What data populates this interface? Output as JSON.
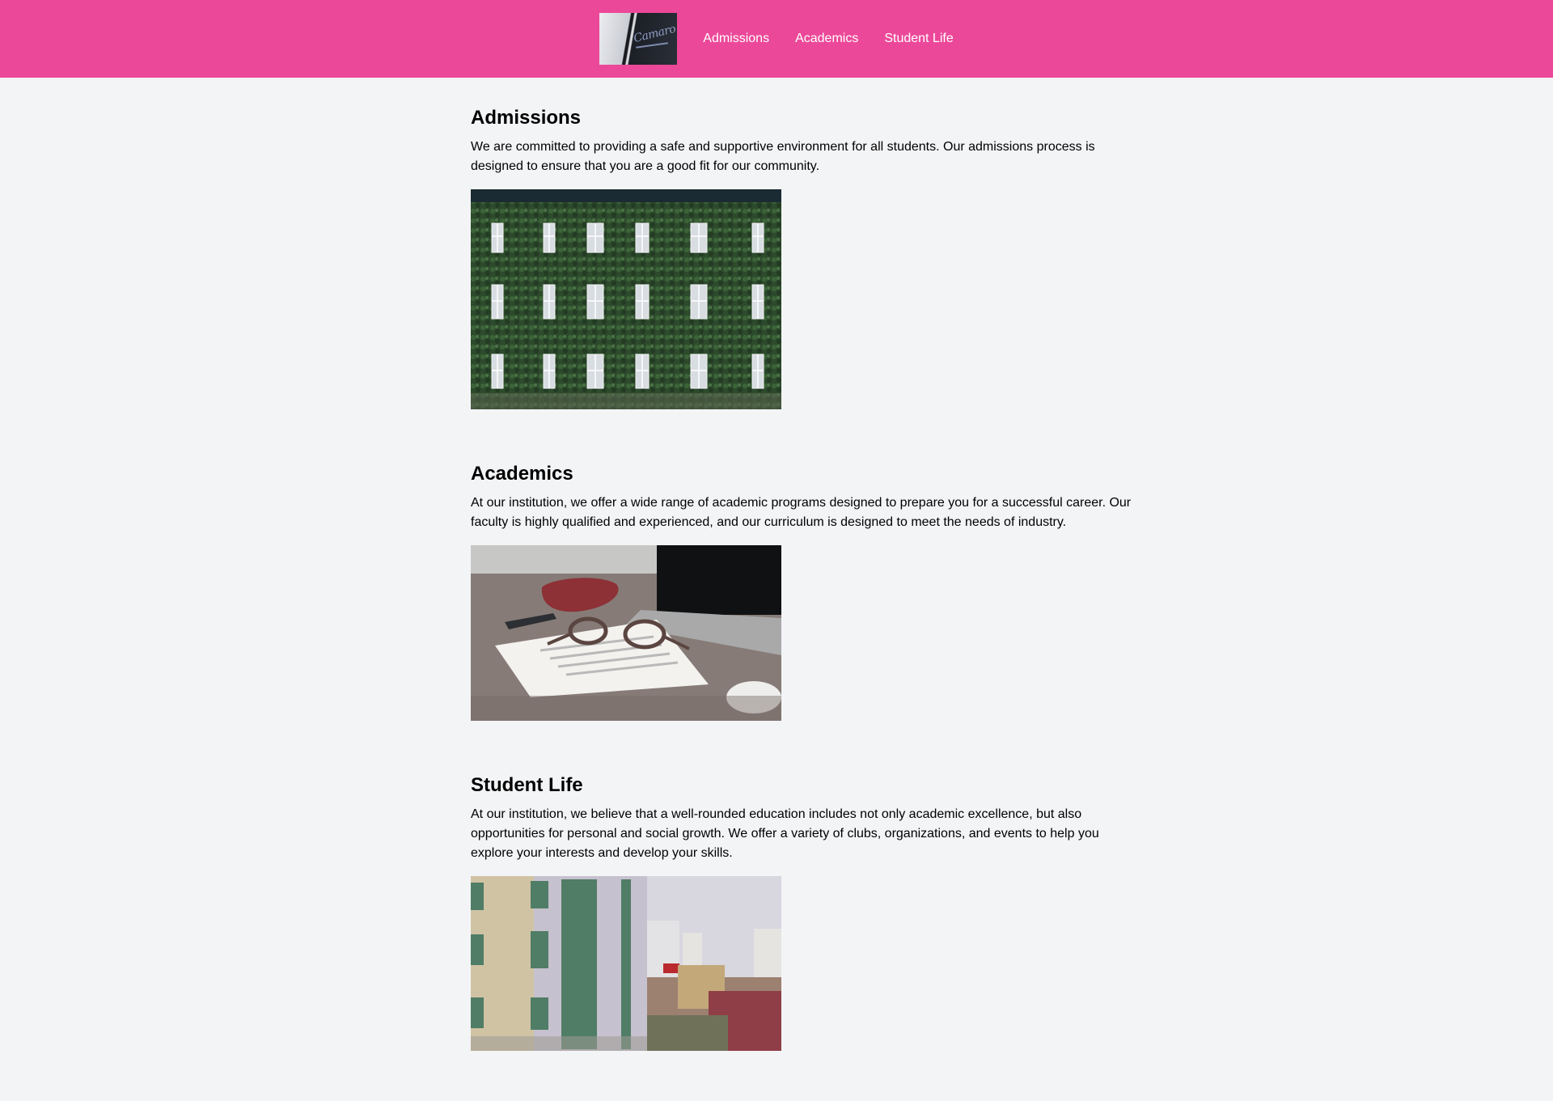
{
  "header": {
    "logo_text": "Camaro",
    "nav": [
      {
        "label": "Admissions"
      },
      {
        "label": "Academics"
      },
      {
        "label": "Student Life"
      }
    ],
    "background": "#ec4899"
  },
  "sections": [
    {
      "title": "Admissions",
      "body": "We are committed to providing a safe and supportive environment for all students. Our admissions process is designed to ensure that you are a good fit for our community.",
      "image": "ivy-covered-building-photo"
    },
    {
      "title": "Academics",
      "body": "At our institution, we offer a wide range of academic programs designed to prepare you for a successful career. Our faculty is highly qualified and experienced, and our curriculum is designed to meet the needs of industry.",
      "image": "laptop-notebook-glasses-photo"
    },
    {
      "title": "Student Life",
      "body": "At our institution, we believe that a well-rounded education includes not only academic excellence, but also opportunities for personal and social growth. We offer a variety of clubs, organizations, and events to help you explore your interests and develop your skills.",
      "image": "city-buildings-photo"
    }
  ]
}
